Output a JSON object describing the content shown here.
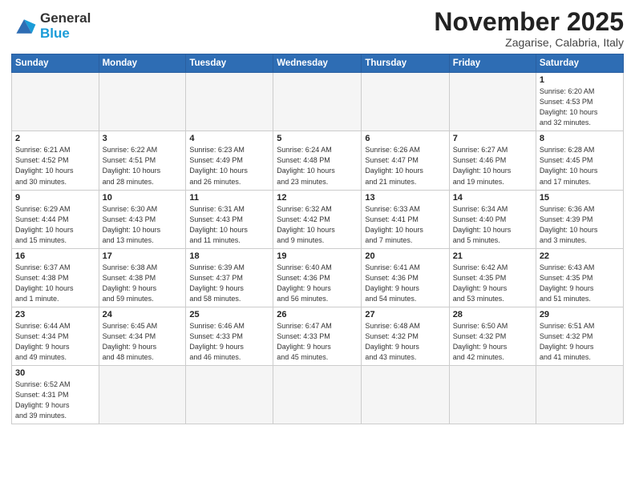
{
  "logo": {
    "line1": "General",
    "line2": "Blue"
  },
  "title": "November 2025",
  "subtitle": "Zagarise, Calabria, Italy",
  "weekdays": [
    "Sunday",
    "Monday",
    "Tuesday",
    "Wednesday",
    "Thursday",
    "Friday",
    "Saturday"
  ],
  "weeks": [
    [
      {
        "day": "",
        "info": ""
      },
      {
        "day": "",
        "info": ""
      },
      {
        "day": "",
        "info": ""
      },
      {
        "day": "",
        "info": ""
      },
      {
        "day": "",
        "info": ""
      },
      {
        "day": "",
        "info": ""
      },
      {
        "day": "1",
        "info": "Sunrise: 6:20 AM\nSunset: 4:53 PM\nDaylight: 10 hours\nand 32 minutes."
      }
    ],
    [
      {
        "day": "2",
        "info": "Sunrise: 6:21 AM\nSunset: 4:52 PM\nDaylight: 10 hours\nand 30 minutes."
      },
      {
        "day": "3",
        "info": "Sunrise: 6:22 AM\nSunset: 4:51 PM\nDaylight: 10 hours\nand 28 minutes."
      },
      {
        "day": "4",
        "info": "Sunrise: 6:23 AM\nSunset: 4:49 PM\nDaylight: 10 hours\nand 26 minutes."
      },
      {
        "day": "5",
        "info": "Sunrise: 6:24 AM\nSunset: 4:48 PM\nDaylight: 10 hours\nand 23 minutes."
      },
      {
        "day": "6",
        "info": "Sunrise: 6:26 AM\nSunset: 4:47 PM\nDaylight: 10 hours\nand 21 minutes."
      },
      {
        "day": "7",
        "info": "Sunrise: 6:27 AM\nSunset: 4:46 PM\nDaylight: 10 hours\nand 19 minutes."
      },
      {
        "day": "8",
        "info": "Sunrise: 6:28 AM\nSunset: 4:45 PM\nDaylight: 10 hours\nand 17 minutes."
      }
    ],
    [
      {
        "day": "9",
        "info": "Sunrise: 6:29 AM\nSunset: 4:44 PM\nDaylight: 10 hours\nand 15 minutes."
      },
      {
        "day": "10",
        "info": "Sunrise: 6:30 AM\nSunset: 4:43 PM\nDaylight: 10 hours\nand 13 minutes."
      },
      {
        "day": "11",
        "info": "Sunrise: 6:31 AM\nSunset: 4:43 PM\nDaylight: 10 hours\nand 11 minutes."
      },
      {
        "day": "12",
        "info": "Sunrise: 6:32 AM\nSunset: 4:42 PM\nDaylight: 10 hours\nand 9 minutes."
      },
      {
        "day": "13",
        "info": "Sunrise: 6:33 AM\nSunset: 4:41 PM\nDaylight: 10 hours\nand 7 minutes."
      },
      {
        "day": "14",
        "info": "Sunrise: 6:34 AM\nSunset: 4:40 PM\nDaylight: 10 hours\nand 5 minutes."
      },
      {
        "day": "15",
        "info": "Sunrise: 6:36 AM\nSunset: 4:39 PM\nDaylight: 10 hours\nand 3 minutes."
      }
    ],
    [
      {
        "day": "16",
        "info": "Sunrise: 6:37 AM\nSunset: 4:38 PM\nDaylight: 10 hours\nand 1 minute."
      },
      {
        "day": "17",
        "info": "Sunrise: 6:38 AM\nSunset: 4:38 PM\nDaylight: 9 hours\nand 59 minutes."
      },
      {
        "day": "18",
        "info": "Sunrise: 6:39 AM\nSunset: 4:37 PM\nDaylight: 9 hours\nand 58 minutes."
      },
      {
        "day": "19",
        "info": "Sunrise: 6:40 AM\nSunset: 4:36 PM\nDaylight: 9 hours\nand 56 minutes."
      },
      {
        "day": "20",
        "info": "Sunrise: 6:41 AM\nSunset: 4:36 PM\nDaylight: 9 hours\nand 54 minutes."
      },
      {
        "day": "21",
        "info": "Sunrise: 6:42 AM\nSunset: 4:35 PM\nDaylight: 9 hours\nand 53 minutes."
      },
      {
        "day": "22",
        "info": "Sunrise: 6:43 AM\nSunset: 4:35 PM\nDaylight: 9 hours\nand 51 minutes."
      }
    ],
    [
      {
        "day": "23",
        "info": "Sunrise: 6:44 AM\nSunset: 4:34 PM\nDaylight: 9 hours\nand 49 minutes."
      },
      {
        "day": "24",
        "info": "Sunrise: 6:45 AM\nSunset: 4:34 PM\nDaylight: 9 hours\nand 48 minutes."
      },
      {
        "day": "25",
        "info": "Sunrise: 6:46 AM\nSunset: 4:33 PM\nDaylight: 9 hours\nand 46 minutes."
      },
      {
        "day": "26",
        "info": "Sunrise: 6:47 AM\nSunset: 4:33 PM\nDaylight: 9 hours\nand 45 minutes."
      },
      {
        "day": "27",
        "info": "Sunrise: 6:48 AM\nSunset: 4:32 PM\nDaylight: 9 hours\nand 43 minutes."
      },
      {
        "day": "28",
        "info": "Sunrise: 6:50 AM\nSunset: 4:32 PM\nDaylight: 9 hours\nand 42 minutes."
      },
      {
        "day": "29",
        "info": "Sunrise: 6:51 AM\nSunset: 4:32 PM\nDaylight: 9 hours\nand 41 minutes."
      }
    ],
    [
      {
        "day": "30",
        "info": "Sunrise: 6:52 AM\nSunset: 4:31 PM\nDaylight: 9 hours\nand 39 minutes."
      },
      {
        "day": "",
        "info": ""
      },
      {
        "day": "",
        "info": ""
      },
      {
        "day": "",
        "info": ""
      },
      {
        "day": "",
        "info": ""
      },
      {
        "day": "",
        "info": ""
      },
      {
        "day": "",
        "info": ""
      }
    ]
  ]
}
